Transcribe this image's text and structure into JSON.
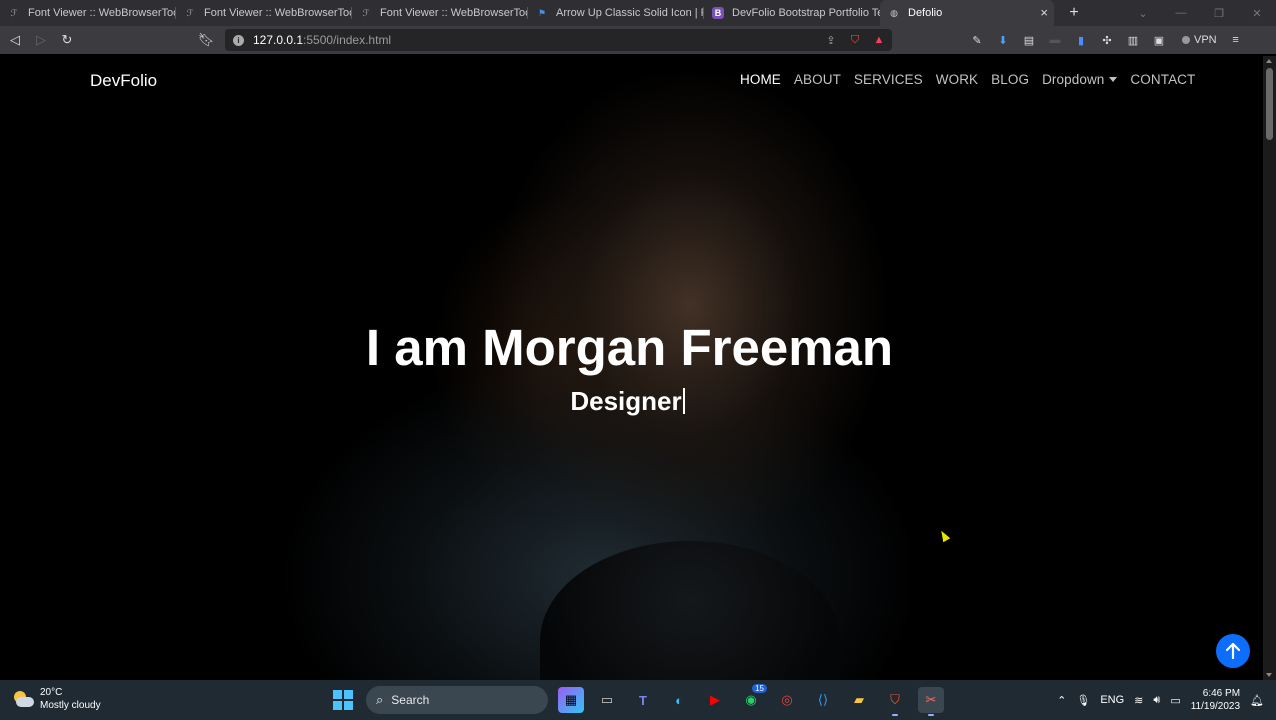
{
  "browser": {
    "tabs": [
      {
        "title": "Font Viewer :: WebBrowserTools",
        "icon": "font-viewer-icon"
      },
      {
        "title": "Font Viewer :: WebBrowserTools",
        "icon": "font-viewer-icon"
      },
      {
        "title": "Font Viewer :: WebBrowserTools",
        "icon": "font-viewer-icon"
      },
      {
        "title": "Arrow Up Classic Solid Icon | Fon",
        "icon": "flag-icon"
      },
      {
        "title": "DevFolio Bootstrap Portfolio Tem",
        "icon": "bootstrap-icon"
      },
      {
        "title": "Defolio",
        "icon": "globe-icon"
      }
    ],
    "url_host": "127.0.0.1",
    "url_path": ":5500/index.html",
    "vpn_label": "VPN"
  },
  "site": {
    "brand": "DevFolio",
    "menu": [
      "HOME",
      "ABOUT",
      "SERVICES",
      "WORK",
      "BLOG",
      "Dropdown",
      "CONTACT"
    ],
    "hero_title": "I am Morgan Freeman",
    "hero_subtitle": "Designer"
  },
  "taskbar": {
    "weather_temp": "20°C",
    "weather_desc": "Mostly cloudy",
    "search_label": "Search",
    "whatsapp_badge": "15",
    "language": "ENG",
    "time": "6:46 PM",
    "date": "11/19/2023"
  },
  "colors": {
    "accent_blue": "#0d6efd",
    "taskbar_bg": "#1f2a33",
    "chrome_bg": "#3b3b40"
  }
}
